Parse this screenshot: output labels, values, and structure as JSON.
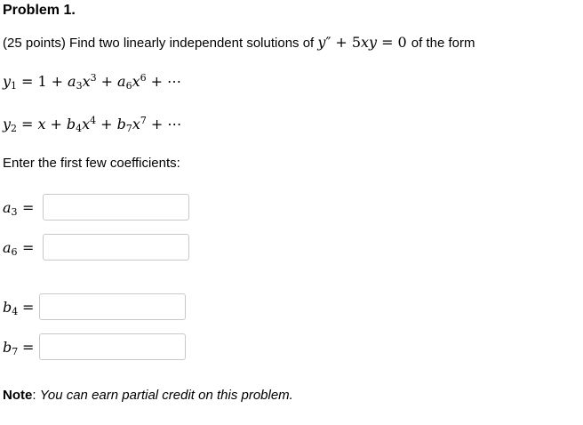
{
  "problem": {
    "title": "Problem 1.",
    "statement_prefix": "(25 points) Find two linearly independent solutions of",
    "statement_suffix": "of the form",
    "ode": {
      "y": "y",
      "prime": "″",
      "plus": "+",
      "coef": "5",
      "x": "x",
      "y2": "y",
      "equals": "=",
      "zero": "0"
    },
    "y1": {
      "lhs": "y",
      "lhs_sub": "1",
      "terms": {
        "one": "1",
        "a3": "a",
        "a3_sub": "3",
        "x3": "x",
        "x3_sup": "3",
        "a6": "a",
        "a6_sub": "6",
        "x6": "x",
        "x6_sup": "6",
        "dots": "⋯"
      }
    },
    "y2": {
      "lhs": "y",
      "lhs_sub": "2",
      "terms": {
        "x": "x",
        "b4": "b",
        "b4_sub": "4",
        "x4": "x",
        "x4_sup": "4",
        "b7": "b",
        "b7_sub": "7",
        "x7": "x",
        "x7_sup": "7",
        "dots": "⋯"
      }
    },
    "prompt": "Enter the first few coefficients:",
    "answers": [
      {
        "symbol": "a",
        "sub": "3",
        "equals": "=",
        "value": "",
        "placeholder": ""
      },
      {
        "symbol": "a",
        "sub": "6",
        "equals": "=",
        "value": "",
        "placeholder": ""
      },
      {
        "symbol": "b",
        "sub": "4",
        "equals": "=",
        "value": "",
        "placeholder": ""
      },
      {
        "symbol": "b",
        "sub": "7",
        "equals": "=",
        "value": "",
        "placeholder": ""
      }
    ],
    "note_label": "Note",
    "note_colon": ":",
    "note_text": "You can earn partial credit on this problem."
  }
}
